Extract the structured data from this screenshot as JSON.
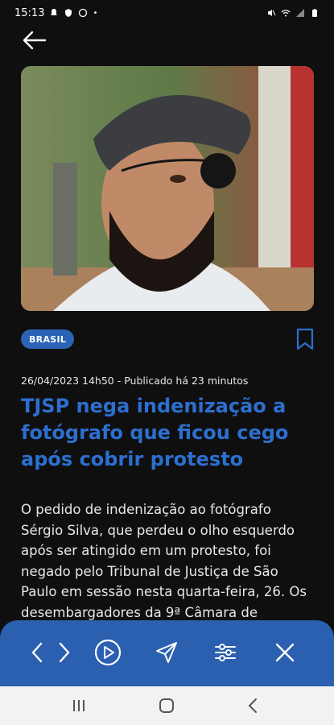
{
  "status_bar": {
    "time": "15:13"
  },
  "article": {
    "category": "BRASIL",
    "meta": "26/04/2023 14h50 - Publicado há 23 minutos",
    "title": "TJSP nega indenização a fotógrafo que ficou cego após cobrir protesto",
    "body": "O pedido de indenização ao fotógrafo Sérgio Silva, que perdeu o olho esquerdo após ser atingido em um protesto, foi negado pelo Tribunal de Justiça de São Paulo em sessão nesta quarta-feira, 26. Os desembargadores da 9ª Câmara de"
  },
  "icons": {
    "status": [
      "bell-icon",
      "shield-icon",
      "whatsapp-icon",
      "mute-icon",
      "wifi-icon",
      "signal-icon",
      "battery-icon"
    ],
    "toolbar": [
      "previous-icon",
      "next-icon",
      "play-icon",
      "share-icon",
      "settings-icon",
      "close-icon"
    ],
    "nav": [
      "recent-apps-icon",
      "home-icon",
      "back-icon"
    ]
  },
  "colors": {
    "accent": "#2c6fcf",
    "toolbar": "#2b5fb0",
    "badge": "#2b64b7",
    "background": "#0f0f0f"
  }
}
